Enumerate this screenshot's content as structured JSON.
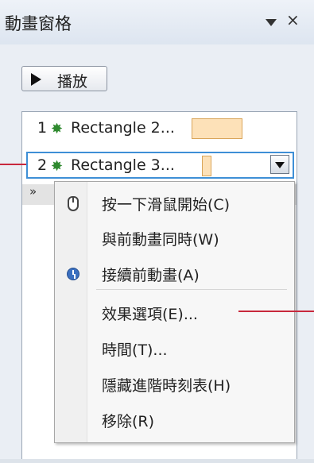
{
  "panel": {
    "title": "動畫窗格",
    "dropdown_icon": "triangle-down-icon",
    "close_label": "×"
  },
  "play_button": {
    "label": "播放",
    "icon": "play-icon"
  },
  "animation_list": [
    {
      "index": "1",
      "name": "Rectangle 2...",
      "icon": "star-effect-icon",
      "bar_color": "#fde1b8"
    },
    {
      "index": "2",
      "name": "Rectangle 3...",
      "icon": "star-effect-icon",
      "bar_color": "#fde1b8",
      "selected": true
    }
  ],
  "context_menu": {
    "items": [
      {
        "label": "按一下滑鼠開始(C)",
        "icon": "mouse-icon"
      },
      {
        "label": "與前動畫同時(W)",
        "icon": ""
      },
      {
        "label": "接續前動畫(A)",
        "icon": "clock-icon"
      },
      {
        "label": "效果選項(E)...",
        "icon": ""
      },
      {
        "label": "時間(T)...",
        "icon": ""
      },
      {
        "label": "隱藏進階時刻表(H)",
        "icon": ""
      },
      {
        "label": "移除(R)",
        "icon": ""
      }
    ]
  },
  "colors": {
    "selection_border": "#3e8fd6",
    "callout_line": "#c8283c",
    "effect_bar": "#fde1b8"
  }
}
